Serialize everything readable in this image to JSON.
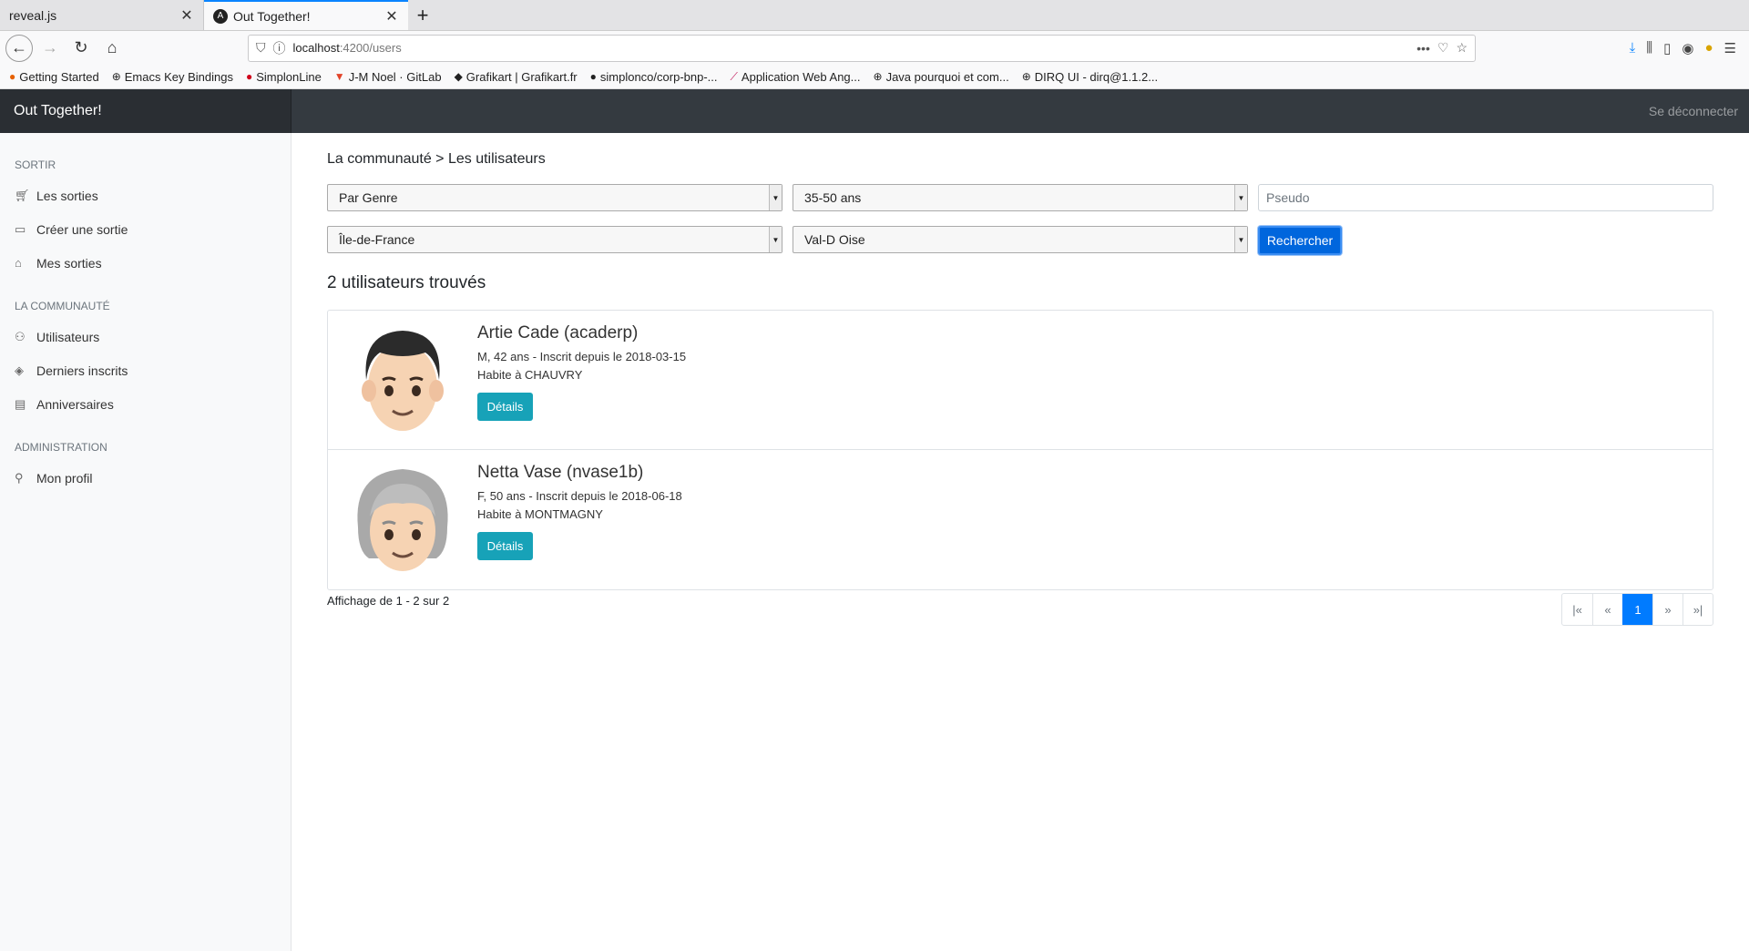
{
  "browser": {
    "tabs": [
      {
        "title": "reveal.js",
        "active": false
      },
      {
        "title": "Out Together!",
        "active": true
      }
    ],
    "url_host": "localhost",
    "url_path": ":4200/users",
    "bookmarks": [
      "Getting Started",
      "Emacs Key Bindings",
      "SimplonLine",
      "J-M Noel · GitLab",
      "Grafikart | Grafikart.fr",
      "simplonco/corp-bnp-...",
      "Application Web Ang...",
      "Java pourquoi et com...",
      "DIRQ UI - dirq@1.1.2..."
    ]
  },
  "app": {
    "brand": "Out Together!",
    "logout": "Se déconnecter",
    "sidebar": {
      "groups": [
        {
          "heading": "SORTIR",
          "items": [
            {
              "label": "Les sorties",
              "icon": "cart-icon"
            },
            {
              "label": "Créer une sortie",
              "icon": "file-icon"
            },
            {
              "label": "Mes sorties",
              "icon": "home-icon"
            }
          ]
        },
        {
          "heading": "LA COMMUNAUTÉ",
          "items": [
            {
              "label": "Utilisateurs",
              "icon": "users-icon"
            },
            {
              "label": "Derniers inscrits",
              "icon": "layers-icon"
            },
            {
              "label": "Anniversaires",
              "icon": "file-text-icon"
            }
          ]
        },
        {
          "heading": "ADMINISTRATION",
          "items": [
            {
              "label": "Mon profil",
              "icon": "user-icon"
            }
          ]
        }
      ]
    },
    "breadcrumb": "La communauté > Les utilisateurs",
    "filters": {
      "gender": "Par Genre",
      "age": "35-50 ans",
      "pseudo_placeholder": "Pseudo",
      "region": "Île-de-France",
      "department": "Val-D Oise",
      "search_label": "Rechercher"
    },
    "result_count": "2 utilisateurs trouvés",
    "users": [
      {
        "name": "Artie Cade (acaderp)",
        "meta": "M, 42 ans - Inscrit depuis le 2018-03-15",
        "city": "Habite à CHAUVRY",
        "details": "Détails",
        "avatar": "man-avatar"
      },
      {
        "name": "Netta Vase (nvase1b)",
        "meta": "F, 50 ans - Inscrit depuis le 2018-06-18",
        "city": "Habite à MONTMAGNY",
        "details": "Détails",
        "avatar": "older-woman-avatar"
      }
    ],
    "showing": "Affichage de 1 - 2 sur 2",
    "pagination": [
      "|«",
      "«",
      "1",
      "»",
      "»|"
    ],
    "active_page": "1"
  }
}
